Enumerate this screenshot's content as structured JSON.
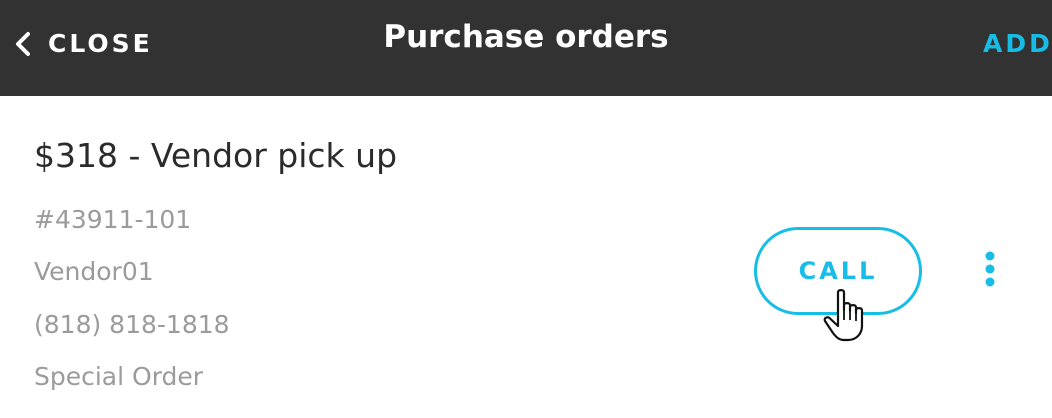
{
  "header": {
    "close_label": "CLOSE",
    "title": "Purchase orders",
    "add_label": "ADD"
  },
  "order": {
    "title": "$318 - Vendor pick up",
    "number": "#43911-101",
    "vendor": "Vendor01",
    "phone": "(818) 818-1818",
    "type": "Special Order",
    "call_label": "CALL"
  },
  "icons": {
    "back": "chevron-left-icon",
    "more": "more-vertical-icon",
    "cursor": "hand-pointer-icon"
  },
  "colors": {
    "topbar_bg": "#323232",
    "accent": "#16bde6",
    "title_text": "#2b2b2b",
    "detail_text": "#9b9b9b"
  }
}
